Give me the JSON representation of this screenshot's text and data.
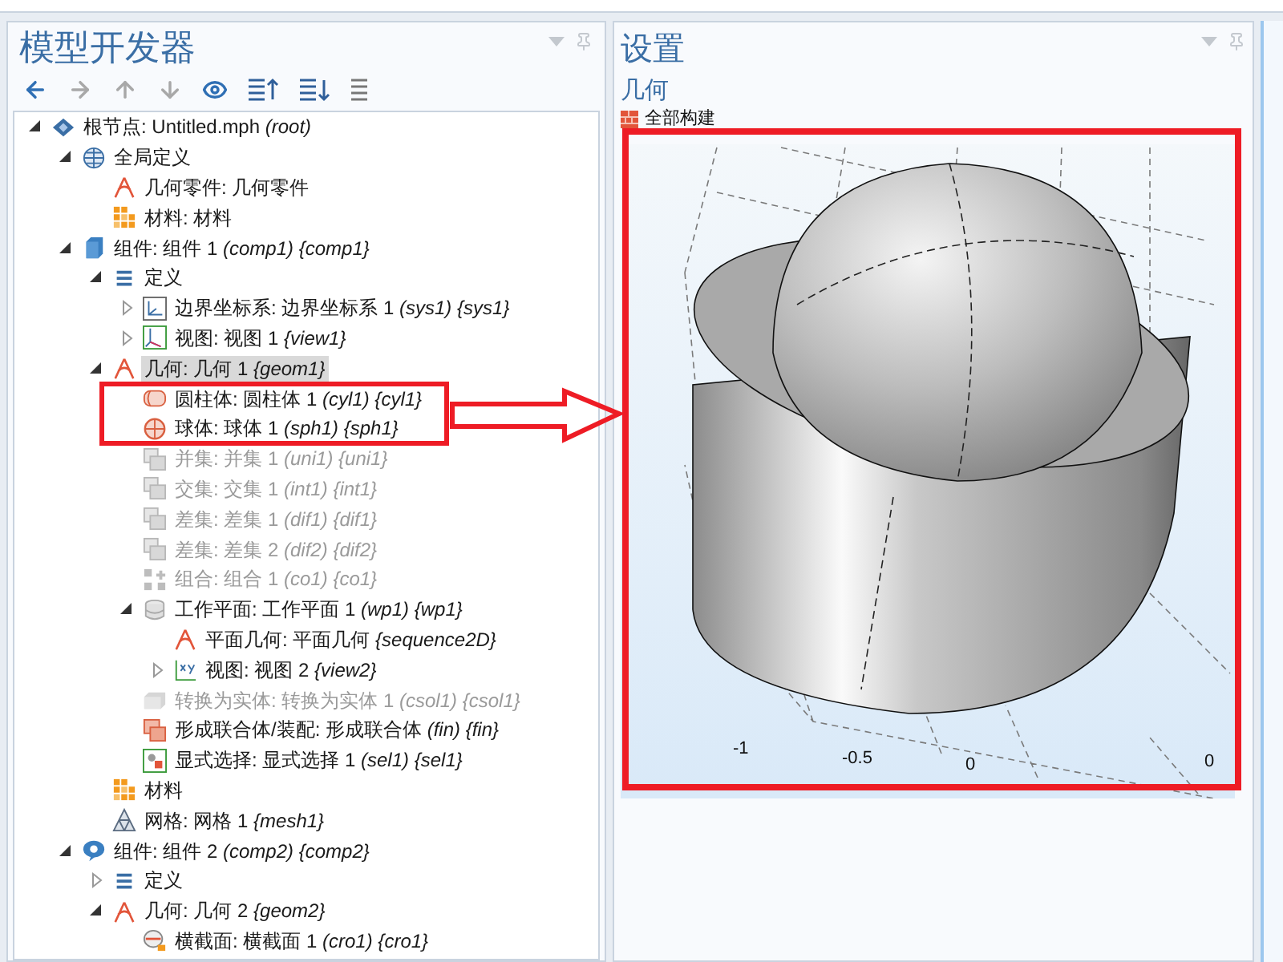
{
  "model_builder": {
    "title": "模型开发器",
    "toolbar": [
      {
        "kind": "back",
        "disabled": false
      },
      {
        "kind": "forward",
        "disabled": true
      },
      {
        "kind": "up",
        "disabled": true
      },
      {
        "kind": "down",
        "disabled": true
      },
      {
        "kind": "show",
        "disabled": false
      },
      {
        "kind": "collapse",
        "disabled": false
      },
      {
        "kind": "expand",
        "disabled": false
      },
      {
        "kind": "list",
        "disabled": false
      }
    ],
    "tree": [
      {
        "kind": "root",
        "label": "根节点: Untitled.mph *(root)*",
        "selected": false,
        "disabled": false,
        "expanded": true,
        "children": [
          {
            "kind": "globe",
            "label": "全局定义",
            "selected": false,
            "disabled": false,
            "expanded": true,
            "children": [
              {
                "kind": "geometry",
                "label": "几何零件: 几何零件",
                "selected": false,
                "disabled": false
              },
              {
                "kind": "material",
                "label": "材料: 材料",
                "selected": false,
                "disabled": false
              }
            ]
          },
          {
            "kind": "component",
            "label": "组件: 组件 1 *(comp1) {comp1}*",
            "selected": false,
            "disabled": false,
            "expanded": true,
            "children": [
              {
                "kind": "list",
                "label": "定义",
                "selected": false,
                "disabled": false,
                "expanded": true,
                "children": [
                  {
                    "kind": "coordinate",
                    "label": "边界坐标系: 边界坐标系 1 *(sys1) {sys1}*",
                    "selected": false,
                    "disabled": false,
                    "expanded": false
                  },
                  {
                    "kind": "view",
                    "label": "视图: 视图 1 *{view1}*",
                    "selected": false,
                    "disabled": false,
                    "expanded": false
                  }
                ]
              },
              {
                "kind": "geometry",
                "label": "几何: 几何 1 *{geom1}*",
                "selected": true,
                "disabled": false,
                "expanded": true,
                "children": [
                  {
                    "kind": "cylinder",
                    "label": "圆柱体: 圆柱体 1 *(cyl1) {cyl1}*",
                    "selected": false,
                    "disabled": false
                  },
                  {
                    "kind": "sphere",
                    "label": "球体: 球体 1 *(sph1) {sph1}*",
                    "selected": false,
                    "disabled": false
                  },
                  {
                    "kind": "boolean",
                    "label": "并集: 并集 1 *(uni1) {uni1}*",
                    "selected": false,
                    "disabled": true
                  },
                  {
                    "kind": "boolean",
                    "label": "交集: 交集 1 *(int1) {int1}*",
                    "selected": false,
                    "disabled": true
                  },
                  {
                    "kind": "boolean",
                    "label": "差集: 差集 1 *(dif1) {dif1}*",
                    "selected": false,
                    "disabled": true
                  },
                  {
                    "kind": "boolean",
                    "label": "差集: 差集 2 *(dif2) {dif2}*",
                    "selected": false,
                    "disabled": true
                  },
                  {
                    "kind": "combine",
                    "label": "组合: 组合 1 *(co1) {co1}*",
                    "selected": false,
                    "disabled": true
                  },
                  {
                    "kind": "workplane",
                    "label": "工作平面: 工作平面 1 *(wp1) {wp1}*",
                    "selected": false,
                    "disabled": false,
                    "expanded": true,
                    "children": [
                      {
                        "kind": "geometry",
                        "label": "平面几何: 平面几何 *{sequence2D}*",
                        "selected": false,
                        "disabled": false
                      },
                      {
                        "kind": "view2d",
                        "label": "视图: 视图 2 *{view2}*",
                        "selected": false,
                        "disabled": false,
                        "expanded": false
                      }
                    ]
                  },
                  {
                    "kind": "convert",
                    "label": "转换为实体: 转换为实体 1 *(csol1) {csol1}*",
                    "selected": false,
                    "disabled": true
                  },
                  {
                    "kind": "assembly",
                    "label": "形成联合体/装配: 形成联合体 *(fin) {fin}*",
                    "selected": false,
                    "disabled": false
                  },
                  {
                    "kind": "selection",
                    "label": "显式选择: 显式选择 1 *(sel1) {sel1}*",
                    "selected": false,
                    "disabled": false
                  }
                ]
              },
              {
                "kind": "material",
                "label": "材料",
                "selected": false,
                "disabled": false
              },
              {
                "kind": "mesh",
                "label": "网格: 网格 1 *{mesh1}*",
                "selected": false,
                "disabled": false
              }
            ]
          },
          {
            "kind": "component2",
            "label": "组件: 组件 2 *(comp2) {comp2}*",
            "selected": false,
            "disabled": false,
            "expanded": true,
            "children": [
              {
                "kind": "list",
                "label": "定义",
                "selected": false,
                "disabled": false,
                "expanded": false
              },
              {
                "kind": "geometry",
                "label": "几何: 几何 2 *{geom2}*",
                "selected": false,
                "disabled": false,
                "expanded": true,
                "children": [
                  {
                    "kind": "crosssection",
                    "label": "横截面: 横截面 1 *(cro1) {cro1}*",
                    "selected": false,
                    "disabled": false
                  }
                ]
              }
            ]
          }
        ]
      }
    ]
  },
  "settings": {
    "title": "设置",
    "section": "几何",
    "build_button": "全部构建",
    "graphics": {
      "axis_labels": [
        "-1",
        "-0.5",
        "0",
        "0"
      ]
    }
  }
}
